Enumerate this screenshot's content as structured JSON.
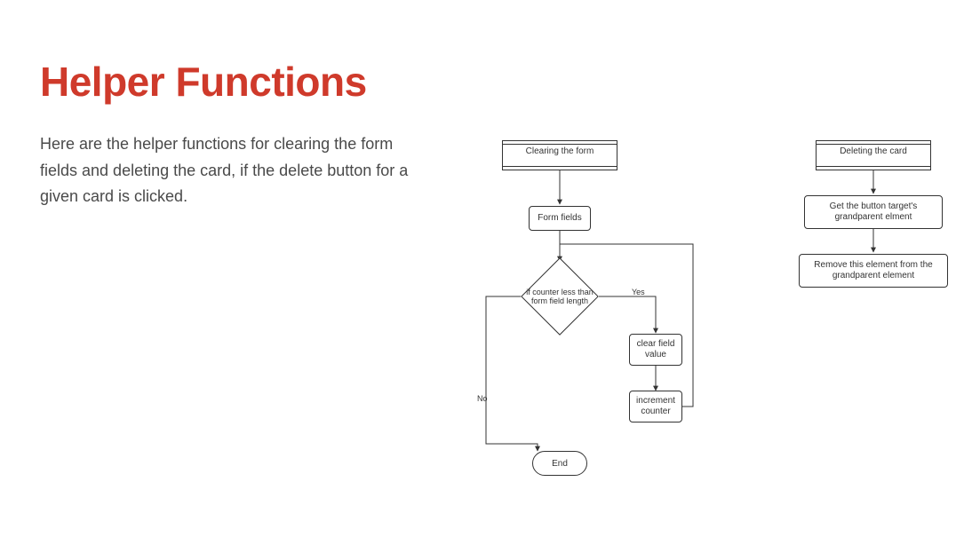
{
  "title": "Helper Functions",
  "intro": "Here are the helper functions for clearing the form fields and deleting the card, if the delete button for a given card is clicked.",
  "flow1": {
    "start": "Clearing the form",
    "step_fields": "Form fields",
    "decision": "if counter less than form field length",
    "yes": "Yes",
    "no": "No",
    "clear": "clear field value",
    "increment": "increment counter",
    "end": "End"
  },
  "flow2": {
    "start": "Deleting the card",
    "grandparent": "Get the button target's grandparent elment",
    "remove": "Remove this element from the grandparent element"
  }
}
